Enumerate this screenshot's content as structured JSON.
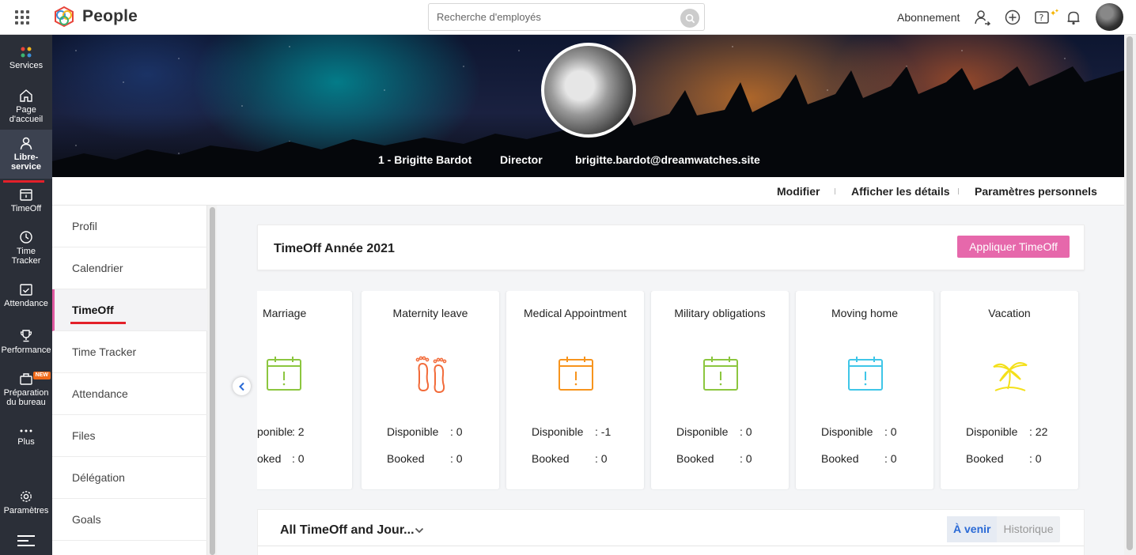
{
  "app": {
    "brand": "People"
  },
  "search": {
    "placeholder": "Recherche d'employés"
  },
  "header": {
    "subscription": "Abonnement"
  },
  "sidebar": {
    "items": [
      {
        "label": "Services"
      },
      {
        "label": "Page d'accueil"
      },
      {
        "label": "Libre-service"
      },
      {
        "label": "TimeOff"
      },
      {
        "label": "Time Tracker"
      },
      {
        "label": "Attendance"
      },
      {
        "label": "Performance"
      },
      {
        "label": "Préparation du bureau",
        "badge": "NEW"
      },
      {
        "label": "Plus"
      },
      {
        "label": "Paramètres"
      }
    ]
  },
  "profile": {
    "name": "1 - Brigitte Bardot",
    "role": "Director",
    "email": "brigitte.bardot@dreamwatches.site"
  },
  "actions": {
    "edit": "Modifier",
    "details": "Afficher les détails",
    "settings": "Paramètres personnels"
  },
  "subnav": {
    "items": [
      {
        "label": "Profil"
      },
      {
        "label": "Calendrier"
      },
      {
        "label": "TimeOff"
      },
      {
        "label": "Time Tracker"
      },
      {
        "label": "Attendance"
      },
      {
        "label": "Files"
      },
      {
        "label": "Délégation"
      },
      {
        "label": "Goals"
      }
    ]
  },
  "timeoff": {
    "title": "TimeOff Année 2021",
    "apply_label": "Appliquer TimeOff",
    "available_label": "Disponible",
    "booked_label": "Booked",
    "cards": [
      {
        "name": "Marriage",
        "available": ": 2",
        "booked": ": 0",
        "icon": "calendar-alert-icon",
        "color": "#8cc63f",
        "cut_available": "ponible",
        "cut_booked": "oked"
      },
      {
        "name": "Maternity leave",
        "available": ": 0",
        "booked": ": 0",
        "icon": "footprints-icon",
        "color": "#f26b3a"
      },
      {
        "name": "Medical Appointment",
        "available": ": -1",
        "booked": ": 0",
        "icon": "calendar-alert-icon",
        "color": "#f7941d"
      },
      {
        "name": "Military obligations",
        "available": ": 0",
        "booked": ": 0",
        "icon": "calendar-alert-icon",
        "color": "#8cc63f"
      },
      {
        "name": "Moving home",
        "available": ": 0",
        "booked": ": 0",
        "icon": "calendar-alert-icon",
        "color": "#3fc6e8"
      },
      {
        "name": "Vacation",
        "available": ": 22",
        "booked": ": 0",
        "icon": "palm-tree-icon",
        "color": "#f4e01a"
      }
    ]
  },
  "journal": {
    "title": "All TimeOff and Jour...",
    "tabs": [
      {
        "label": "À venir"
      },
      {
        "label": "Historique"
      }
    ]
  },
  "colors": {
    "accent": "#e668ab",
    "sidebar_bg": "#2b2f38",
    "active_underline": "#e3202a",
    "tab_active": "#2a6ad6"
  }
}
